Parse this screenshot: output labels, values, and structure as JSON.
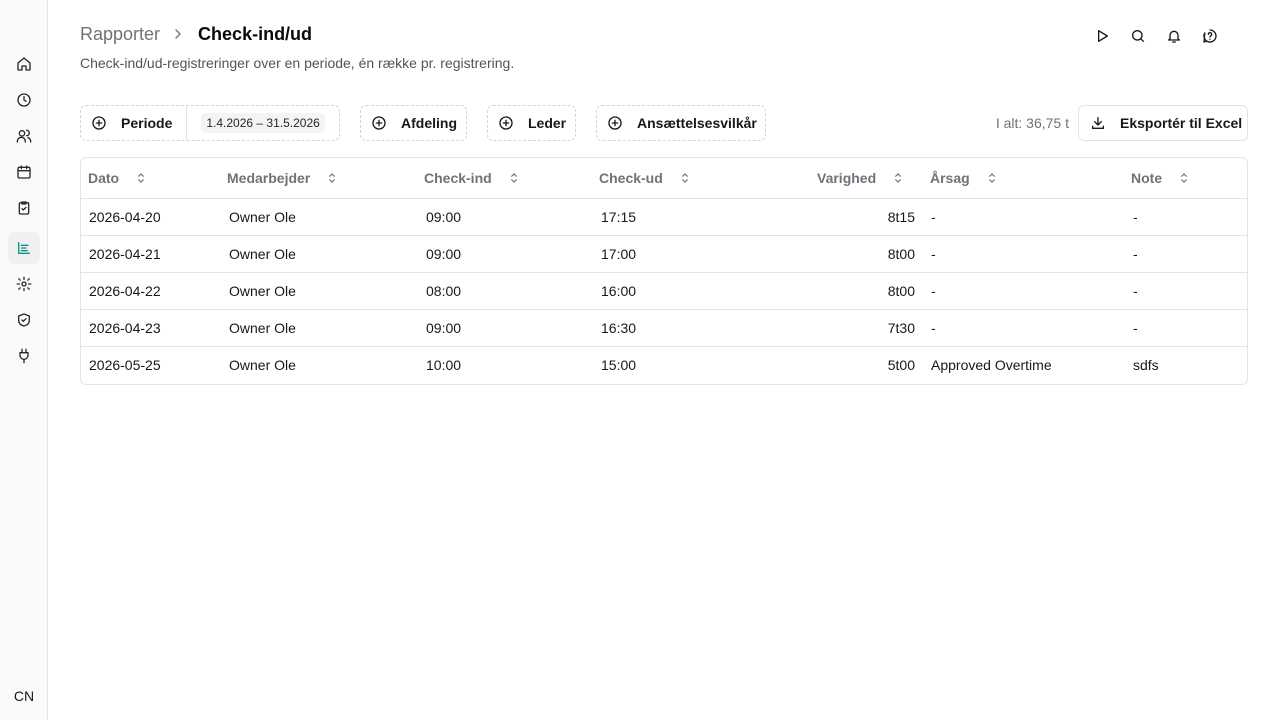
{
  "breadcrumb": {
    "parent": "Rapporter",
    "current": "Check-ind/ud"
  },
  "subtitle": "Check-ind/ud-registreringer over en periode, én række pr. registrering.",
  "sidebar": {
    "items": [
      {
        "icon": "home-icon"
      },
      {
        "icon": "clock-icon"
      },
      {
        "icon": "users-icon"
      },
      {
        "icon": "calendar-icon"
      },
      {
        "icon": "clipboard-check-icon"
      },
      {
        "icon": "report-icon",
        "active": true
      },
      {
        "icon": "gear-icon"
      },
      {
        "icon": "shield-check-icon"
      },
      {
        "icon": "plug-icon"
      }
    ],
    "avatar": "CN"
  },
  "top_icons": [
    "play-icon",
    "search-icon",
    "bell-icon",
    "help-icon"
  ],
  "filters": {
    "period_label": "Periode",
    "period_value": "1.4.2026 – 31.5.2026",
    "department_label": "Afdeling",
    "manager_label": "Leder",
    "terms_label": "Ansættelsesvilkår"
  },
  "total": "I alt: 36,75 t",
  "export_label": "Eksportér til Excel",
  "table": {
    "columns": [
      "Dato",
      "Medarbejder",
      "Check-ind",
      "Check-ud",
      "Varighed",
      "Årsag",
      "Note"
    ],
    "rows": [
      [
        "2026-04-20",
        "Owner Ole",
        "09:00",
        "17:15",
        "8t15",
        "-",
        "-"
      ],
      [
        "2026-04-21",
        "Owner Ole",
        "09:00",
        "17:00",
        "8t00",
        "-",
        "-"
      ],
      [
        "2026-04-22",
        "Owner Ole",
        "08:00",
        "16:00",
        "8t00",
        "-",
        "-"
      ],
      [
        "2026-04-23",
        "Owner Ole",
        "09:00",
        "16:30",
        "7t30",
        "-",
        "-"
      ],
      [
        "2026-05-25",
        "Owner Ole",
        "10:00",
        "15:00",
        "5t00",
        "Approved Overtime",
        "sdfs"
      ]
    ]
  },
  "colors": {
    "accent": "#0d9488",
    "muted_text": "#71717a",
    "border": "#e4e4e7"
  }
}
